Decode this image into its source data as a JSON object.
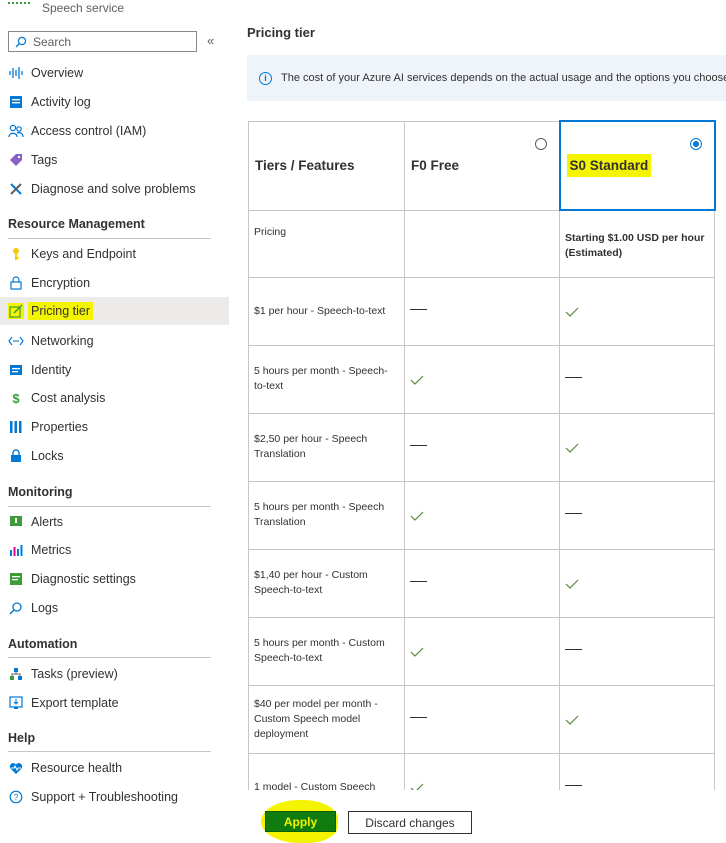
{
  "service": {
    "title": "Speech service"
  },
  "search": {
    "placeholder": "Search",
    "collapse_glyph": "«"
  },
  "nav": {
    "top": [
      {
        "label": "Overview",
        "icon": "waveform-icon"
      },
      {
        "label": "Activity log",
        "icon": "activity-log-icon"
      },
      {
        "label": "Access control (IAM)",
        "icon": "people-icon"
      },
      {
        "label": "Tags",
        "icon": "tag-icon"
      },
      {
        "label": "Diagnose and solve problems",
        "icon": "wrench-icon"
      }
    ],
    "sections": [
      {
        "title": "Resource Management",
        "items": [
          {
            "label": "Keys and Endpoint",
            "icon": "key-icon"
          },
          {
            "label": "Encryption",
            "icon": "lock-outline-icon"
          },
          {
            "label": "Pricing tier",
            "icon": "edit-icon",
            "selected": true
          },
          {
            "label": "Networking",
            "icon": "network-icon"
          },
          {
            "label": "Identity",
            "icon": "identity-icon"
          },
          {
            "label": "Cost analysis",
            "icon": "cost-icon"
          },
          {
            "label": "Properties",
            "icon": "properties-icon"
          },
          {
            "label": "Locks",
            "icon": "lock-icon"
          }
        ]
      },
      {
        "title": "Monitoring",
        "items": [
          {
            "label": "Alerts",
            "icon": "alert-icon"
          },
          {
            "label": "Metrics",
            "icon": "metrics-icon"
          },
          {
            "label": "Diagnostic settings",
            "icon": "diagnostic-icon"
          },
          {
            "label": "Logs",
            "icon": "logs-icon"
          }
        ]
      },
      {
        "title": "Automation",
        "items": [
          {
            "label": "Tasks (preview)",
            "icon": "tasks-icon"
          },
          {
            "label": "Export template",
            "icon": "export-icon"
          }
        ]
      },
      {
        "title": "Help",
        "items": [
          {
            "label": "Resource health",
            "icon": "heart-icon"
          },
          {
            "label": "Support + Troubleshooting",
            "icon": "question-icon"
          }
        ]
      }
    ]
  },
  "main": {
    "title": "Pricing tier",
    "info": "The cost of your Azure AI services depends on the actual usage and the options you choose b",
    "table": {
      "corner": "Tiers / Features",
      "tiers": [
        {
          "name": "F0 Free",
          "selected": false
        },
        {
          "name": "S0 Standard",
          "selected": true
        }
      ],
      "pricing": {
        "label": "Pricing",
        "f0": "",
        "s0": "Starting $1.00 USD per hour (Estimated)"
      },
      "rows": [
        {
          "feature": "$1 per hour - Speech-to-text",
          "f0": "dash",
          "s0": "check"
        },
        {
          "feature": "5 hours per month - Speech-to-text",
          "f0": "check",
          "s0": "dash"
        },
        {
          "feature": "$2,50 per hour - Speech Translation",
          "f0": "dash",
          "s0": "check"
        },
        {
          "feature": "5 hours per month - Speech Translation",
          "f0": "check",
          "s0": "dash"
        },
        {
          "feature": "$1,40 per hour - Custom Speech-to-text",
          "f0": "dash",
          "s0": "check"
        },
        {
          "feature": "5 hours per month - Custom Speech-to-text",
          "f0": "check",
          "s0": "dash"
        },
        {
          "feature": "$40 per model per month - Custom Speech model deployment",
          "f0": "dash",
          "s0": "check"
        },
        {
          "feature": "1 model - Custom Speech",
          "f0": "check",
          "s0": "dash"
        }
      ]
    }
  },
  "actions": {
    "apply": "Apply",
    "discard": "Discard changes"
  },
  "colors": {
    "accent": "#0078d4",
    "highlight": "#f4f400",
    "apply_bg": "#107c10",
    "check": "#5a8a3a"
  }
}
